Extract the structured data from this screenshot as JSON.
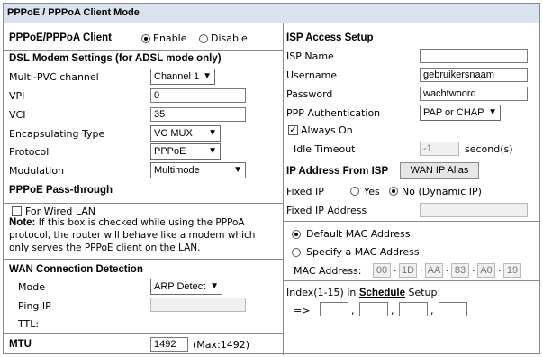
{
  "page_title": "PPPoE / PPPoA Client Mode",
  "left": {
    "client_label": "PPPoE/PPPoA Client",
    "client_enable": "Enable",
    "client_disable": "Disable",
    "client_selected": "Enable",
    "dsl_heading": "DSL Modem Settings (for ADSL mode only)",
    "multi_pvc_label": "Multi-PVC channel",
    "multi_pvc_value": "Channel 1",
    "vpi_label": "VPI",
    "vpi_value": "0",
    "vci_label": "VCI",
    "vci_value": "35",
    "encap_label": "Encapsulating Type",
    "encap_value": "VC MUX",
    "protocol_label": "Protocol",
    "protocol_value": "PPPoE",
    "modulation_label": "Modulation",
    "modulation_value": "Multimode",
    "passthrough_heading": "PPPoE Pass-through",
    "wired_lan_label": "For Wired LAN",
    "wired_lan_checked": false,
    "note_bold": "Note:",
    "note_text": " If this box is checked while using the PPPoA protocol, the router will behave like a modem which only serves the PPPoE client on the LAN.",
    "wan_heading": "WAN Connection Detection",
    "mode_label": "Mode",
    "mode_value": "ARP Detect",
    "ping_ip_label": "Ping IP",
    "ping_ip_value": "",
    "ttl_label": "TTL:",
    "mtu_label": "MTU",
    "mtu_value": "1492",
    "mtu_max": "(Max:1492)"
  },
  "right": {
    "isp_heading": "ISP Access Setup",
    "isp_name_label": "ISP Name",
    "isp_name_value": "",
    "username_label": "Username",
    "username_value": "gebruikersnaam",
    "password_label": "Password",
    "password_value": "wachtwoord",
    "ppp_auth_label": "PPP Authentication",
    "ppp_auth_value": "PAP or CHAP",
    "always_on_label": "Always On",
    "always_on_checked": true,
    "idle_timeout_label": "Idle Timeout",
    "idle_timeout_value": "-1",
    "idle_timeout_unit": "second(s)",
    "ip_from_isp_heading": "IP Address From ISP",
    "wan_ip_alias_button": "WAN IP Alias",
    "fixed_ip_label": "Fixed IP",
    "fixed_ip_yes": "Yes",
    "fixed_ip_no": "No (Dynamic IP)",
    "fixed_ip_selected": "No",
    "fixed_ip_address_label": "Fixed IP Address",
    "fixed_ip_address_value": "",
    "default_mac_label": "Default MAC Address",
    "specify_mac_label": "Specify a MAC Address",
    "mac_selected": "Default MAC Address",
    "mac_address_label": "MAC Address:",
    "mac_octets": [
      "00",
      "1D",
      "AA",
      "83",
      "A0",
      "19"
    ],
    "index_label_pre": "Index(1-15) in ",
    "index_schedule_link": "Schedule",
    "index_label_post": " Setup:",
    "index_arrow": "=>",
    "index_values": [
      "",
      "",
      "",
      ""
    ]
  },
  "colors": {
    "header_bg": "#d9e2ee",
    "border": "#8a8a8a",
    "disabled_bg": "#f0f0f0"
  },
  "icons": {
    "select_chevron": "chevron-down-icon",
    "checkbox_mark": "checkmark-icon"
  }
}
